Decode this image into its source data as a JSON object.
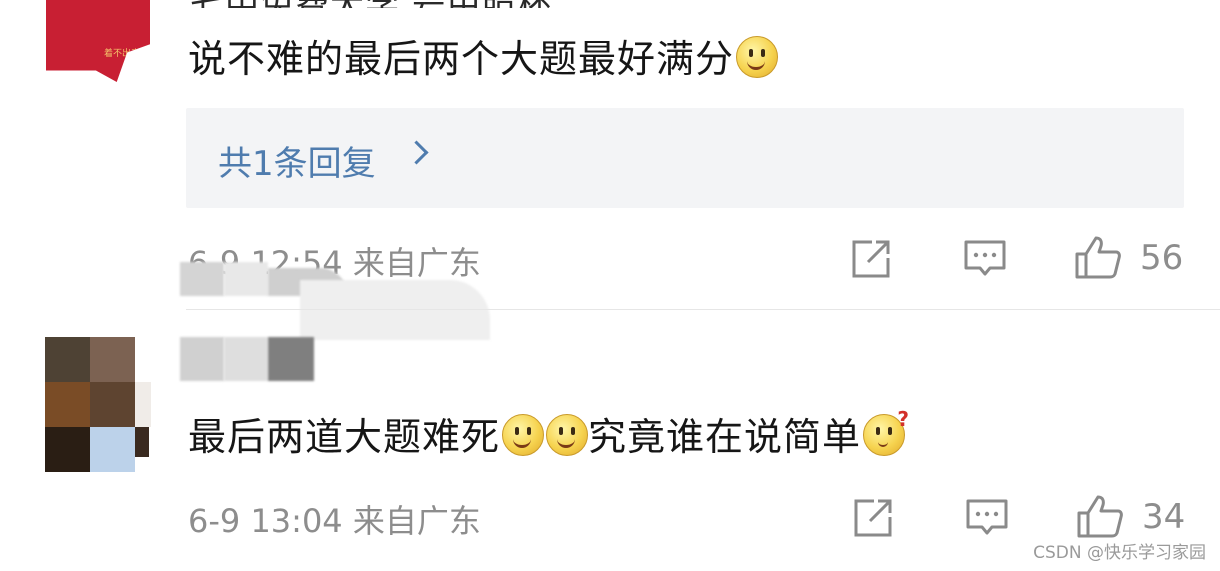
{
  "comment1": {
    "top_cut_text": "七中免费大学 号由照杯",
    "avatar_text": "着不出来",
    "text": "说不难的最后两个大题最好满分",
    "emojis": [
      "smile-emoji"
    ],
    "reply_link": "共1条回复",
    "meta": "6-9 12:54 来自广东",
    "likes": "56"
  },
  "comment2": {
    "text_part1": "最后两道大题难死",
    "text_part2": "究竟谁在说简单",
    "emojis": [
      "smile-emoji",
      "smile-emoji",
      "thinking-emoji"
    ],
    "meta": "6-9 13:04 来自广东",
    "likes": "34"
  },
  "icons": [
    "share-icon",
    "comment-icon",
    "like-icon",
    "chevron-right-icon"
  ],
  "colors": {
    "avatar_red": "#c81f33",
    "link_blue": "#4f7cae",
    "meta_gray": "#8d8d8d",
    "reply_bg": "#f3f4f6"
  },
  "watermark": "CSDN @快乐学习家园"
}
